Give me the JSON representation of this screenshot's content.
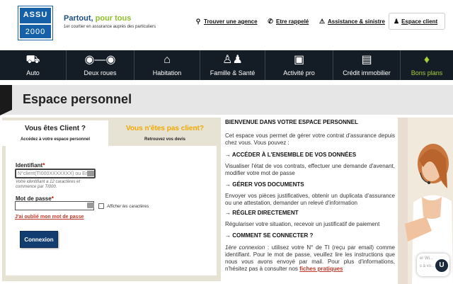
{
  "header": {
    "logo": {
      "line1": "ASSU",
      "line2": "2000"
    },
    "tagline_a": "Partout,",
    "tagline_b": "pour tous",
    "subtagline": "1er courtier en assurance auprès des particuliers",
    "links": [
      {
        "label": "Trouver une agence",
        "icon": "map-pin-icon"
      },
      {
        "label": "Etre rappelé",
        "icon": "phone-icon"
      },
      {
        "label": "Assistance & sinistre",
        "icon": "warning-icon"
      }
    ],
    "account_button": {
      "label": "Espace client",
      "icon": "user-icon"
    }
  },
  "nav": [
    {
      "label": "Auto",
      "icon": "car-icon"
    },
    {
      "label": "Deux roues",
      "icon": "motorbike-icon"
    },
    {
      "label": "Habitation",
      "icon": "house-icon"
    },
    {
      "label": "Famille & Santé",
      "icon": "family-icon"
    },
    {
      "label": "Activité pro",
      "icon": "briefcase-icon"
    },
    {
      "label": "Crédit immobilier",
      "icon": "chart-icon"
    },
    {
      "label": "Bons plans",
      "icon": "tag-icon"
    }
  ],
  "colors": {
    "nav_bg": "#141c25",
    "accent_green": "#a6cf3a",
    "accent_orange": "#f0a800",
    "brand_blue": "#1660a7",
    "link_red": "#c0392b"
  },
  "page_title": "Espace personnel",
  "tabs": [
    {
      "title": "Vous êtes Client ?",
      "subtitle": "Accédez à votre espace personnel"
    },
    {
      "title": "Vous n'êtes pas client?",
      "subtitle": "Retrouvez vos devis"
    }
  ],
  "form": {
    "id_label": "Identifiant",
    "required_mark": "*",
    "id_placeholder": "N°client(TI000XXXXXXX) ou Email",
    "id_hint": "Votre identifiant a 12 caractères et commence par TI000.",
    "password_label": "Mot de passe",
    "password_placeholder": "",
    "show_chars_label": "Afficher les caractères",
    "forgot_label": "J'ai oublié mon mot de passe",
    "submit_label": "Connexion"
  },
  "info": {
    "welcome": "BIENVENUE DANS VOTRE ESPACE PERSONNEL",
    "intro": "Cet espace vous permet de gérer votre contrat d'assurance depuis chez vous. Vous pouvez :",
    "sections": [
      {
        "title": "→ ACCÉDER À L'ENSEMBLE DE VOS DONNÉES",
        "text": "Visualiser l'état de vos contrats, effectuer une demande d'avenant, modifier votre mot de passe"
      },
      {
        "title": "→ GÉRER VOS DOCUMENTS",
        "text": "Envoyer vos pièces justificatives, obtenir un duplicata d'assurance ou une attestation, demander un relevé d'information"
      },
      {
        "title": "→ RÉGLER DIRECTEMENT",
        "text": "Régulariser votre situation, recevoir un justificatif de paiement"
      },
      {
        "title": "→ COMMENT SE CONNECTER ?",
        "text": ""
      }
    ],
    "first_connexion_label": "1ère connexion",
    "first_connexion_text": " : utilisez votre N° de TI (reçu par email) comme identifiant. Pour le mot de passe, veuillez lire les instructions que nous vous avons envoyé par mail. Pour plus d'informations, n'hésitez pas à consulter nos ",
    "faq_link": "fiches pratiques"
  },
  "chat": {
    "line1": "er Wi...",
    "line2": "s à vo...",
    "badge": "U"
  }
}
